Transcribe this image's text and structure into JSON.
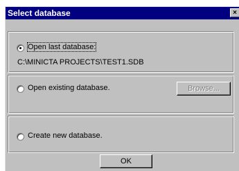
{
  "window": {
    "title": "Select database",
    "close_label": "×"
  },
  "options": {
    "open_last": {
      "label": "Open last database:",
      "checked": true,
      "path": "C:\\MINICTA PROJECTS\\TEST1.SDB"
    },
    "open_existing": {
      "label": "Open existing database.",
      "checked": false,
      "browse_label": "Browse..."
    },
    "create_new": {
      "label": "Create new database.",
      "checked": false
    }
  },
  "buttons": {
    "ok_label": "OK"
  }
}
